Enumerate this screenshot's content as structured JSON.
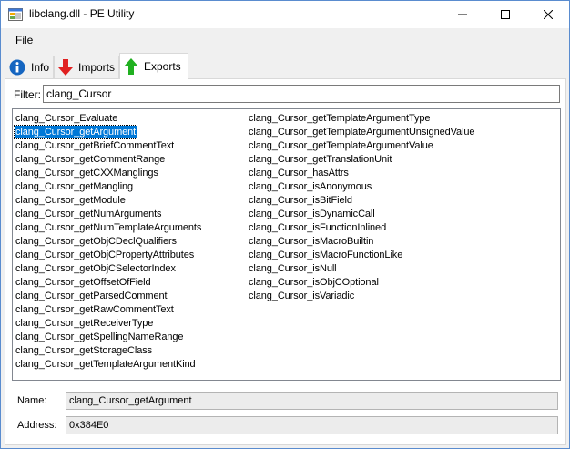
{
  "window": {
    "title": "libclang.dll - PE Utility"
  },
  "menu": {
    "file": "File"
  },
  "tabs": [
    {
      "label": "Info",
      "icon": "info-icon"
    },
    {
      "label": "Imports",
      "icon": "red-down-arrow-icon"
    },
    {
      "label": "Exports",
      "icon": "green-up-arrow-icon",
      "active": true
    }
  ],
  "filter": {
    "label": "Filter:",
    "value": "clang_Cursor"
  },
  "exports": {
    "column1": [
      "clang_Cursor_Evaluate",
      "clang_Cursor_getArgument",
      "clang_Cursor_getBriefCommentText",
      "clang_Cursor_getCommentRange",
      "clang_Cursor_getCXXManglings",
      "clang_Cursor_getMangling",
      "clang_Cursor_getModule",
      "clang_Cursor_getNumArguments",
      "clang_Cursor_getNumTemplateArguments",
      "clang_Cursor_getObjCDeclQualifiers",
      "clang_Cursor_getObjCPropertyAttributes",
      "clang_Cursor_getObjCSelectorIndex",
      "clang_Cursor_getOffsetOfField",
      "clang_Cursor_getParsedComment",
      "clang_Cursor_getRawCommentText",
      "clang_Cursor_getReceiverType",
      "clang_Cursor_getSpellingNameRange",
      "clang_Cursor_getStorageClass",
      "clang_Cursor_getTemplateArgumentKind"
    ],
    "column2": [
      "clang_Cursor_getTemplateArgumentType",
      "clang_Cursor_getTemplateArgumentUnsignedValue",
      "clang_Cursor_getTemplateArgumentValue",
      "clang_Cursor_getTranslationUnit",
      "clang_Cursor_hasAttrs",
      "clang_Cursor_isAnonymous",
      "clang_Cursor_isBitField",
      "clang_Cursor_isDynamicCall",
      "clang_Cursor_isFunctionInlined",
      "clang_Cursor_isMacroBuiltin",
      "clang_Cursor_isMacroFunctionLike",
      "clang_Cursor_isNull",
      "clang_Cursor_isObjCOptional",
      "clang_Cursor_isVariadic"
    ],
    "selected": "clang_Cursor_getArgument"
  },
  "details": {
    "name_label": "Name:",
    "name_value": "clang_Cursor_getArgument",
    "address_label": "Address:",
    "address_value": "0x384E0"
  },
  "colors": {
    "selection": "#0078d7",
    "info_blue": "#1565c0",
    "imports_red": "#e02020",
    "exports_green": "#20b020"
  }
}
